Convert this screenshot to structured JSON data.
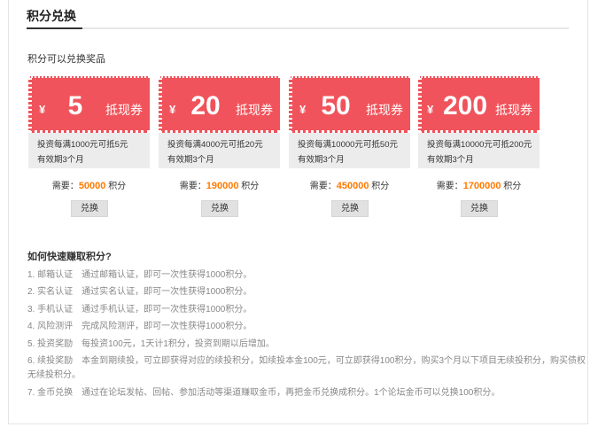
{
  "header": {
    "title": "积分兑换"
  },
  "intro": "积分可以兑换奖品",
  "coupons": [
    {
      "yen": "¥",
      "amount": "5",
      "kind": "抵现券",
      "line1": "投资每满1000元可抵5元",
      "line2": "有效期3个月",
      "cost_prefix": "需要：",
      "cost_value": "50000",
      "cost_unit": "积分",
      "button": "兑换"
    },
    {
      "yen": "¥",
      "amount": "20",
      "kind": "抵现券",
      "line1": "投资每满4000元可抵20元",
      "line2": "有效期3个月",
      "cost_prefix": "需要：",
      "cost_value": "190000",
      "cost_unit": "积分",
      "button": "兑换"
    },
    {
      "yen": "¥",
      "amount": "50",
      "kind": "抵现券",
      "line1": "投资每满10000元可抵50元",
      "line2": "有效期3个月",
      "cost_prefix": "需要：",
      "cost_value": "450000",
      "cost_unit": "积分",
      "button": "兑换"
    },
    {
      "yen": "¥",
      "amount": "200",
      "kind": "抵现券",
      "line1": "投资每满10000元可抵200元",
      "line2": "有效期3个月",
      "cost_prefix": "需要：",
      "cost_value": "1700000",
      "cost_unit": "积分",
      "button": "兑换"
    }
  ],
  "howto": {
    "title": "如何快速赚取积分?",
    "rules": [
      "1. 邮箱认证　通过邮箱认证，即可一次性获得1000积分。",
      "2. 实名认证　通过实名认证，即可一次性获得1000积分。",
      "3. 手机认证　通过手机认证，即可一次性获得1000积分。",
      "4. 风险测评　完成风险测评，即可一次性获得1000积分。",
      "5. 投资奖励　每投资100元，1天计1积分，投资到期以后增加。",
      "6. 续投奖励　本金到期续投，可立即获得对应的续投积分，如续投本金100元，可立即获得100积分，购买3个月以下项目无续投积分，购买债权",
      "无续投积分。",
      "7. 金币兑换　通过在论坛发帖、回帖、参加活动等渠道赚取金币，再把金币兑换成积分。1个论坛金币可以兑换100积分。"
    ]
  }
}
